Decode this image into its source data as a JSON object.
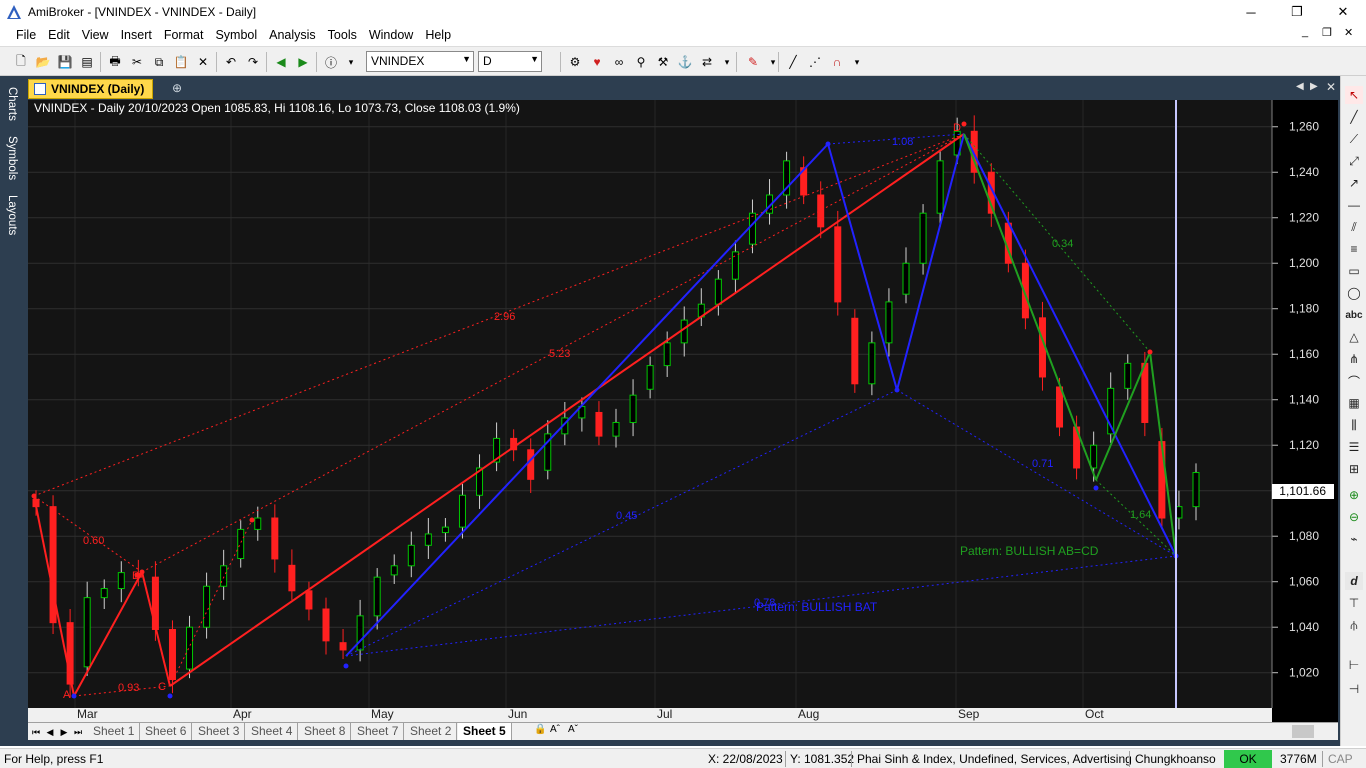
{
  "window": {
    "title": "AmiBroker - [VNINDEX - VNINDEX - Daily]"
  },
  "menu": {
    "items": [
      "File",
      "Edit",
      "View",
      "Insert",
      "Format",
      "Symbol",
      "Analysis",
      "Tools",
      "Window",
      "Help"
    ]
  },
  "toolbar": {
    "symbol_value": "VNINDEX",
    "interval_value": "D"
  },
  "sidebar": {
    "tabs": [
      "Charts",
      "Symbols",
      "Layouts"
    ]
  },
  "chart": {
    "tab_label": "VNINDEX (Daily)",
    "header": "VNINDEX - Daily 20/10/2023 Open 1085.83, Hi 1108.16, Lo 1073.73, Close 1108.03 (1.9%)",
    "last_price": "1,101.66",
    "pattern_green": "Pattern: BULLISH AB=CD",
    "pattern_blue": "Pattern: BULLISH BAT",
    "ratios": {
      "r1": "0.60",
      "r2": "0.93",
      "r3": "2.96",
      "r4": "5.23",
      "r5": "0.45",
      "r6": "1.08",
      "r7": "0.34",
      "r8": "0.71",
      "r9": "1.64",
      "r10": "0.78"
    },
    "points": {
      "A": "A",
      "B": "B",
      "C": "C",
      "D": "D"
    }
  },
  "chart_data": {
    "type": "candlestick",
    "title": "VNINDEX - Daily",
    "y_ticks": [
      1020,
      1040,
      1060,
      1080,
      1100,
      1120,
      1140,
      1160,
      1180,
      1200,
      1220,
      1240,
      1260
    ],
    "y_tick_labels": [
      "1,020",
      "1,040",
      "1,060",
      "1,080",
      "1,100",
      "1,120",
      "1,140",
      "1,160",
      "1,180",
      "1,200",
      "1,220",
      "1,240",
      "1,260"
    ],
    "x_month_labels": [
      "Mar",
      "Apr",
      "May",
      "Jun",
      "Jul",
      "Aug",
      "Sep",
      "Oct"
    ],
    "ylim": [
      1008,
      1270
    ],
    "last_value": 1101.66,
    "grid": true,
    "sample_closes": [
      1093,
      1042,
      1015,
      1053,
      1057,
      1064,
      1062,
      1039,
      1017,
      1040,
      1058,
      1067,
      1083,
      1088,
      1070,
      1056,
      1048,
      1034,
      1030,
      1045,
      1062,
      1067,
      1076,
      1081,
      1084,
      1098,
      1110,
      1123,
      1118,
      1105,
      1125,
      1132,
      1137,
      1124,
      1130,
      1142,
      1155,
      1165,
      1175,
      1182,
      1193,
      1205,
      1222,
      1230,
      1245,
      1230,
      1216,
      1183,
      1147,
      1165,
      1183,
      1200,
      1222,
      1245,
      1258,
      1240,
      1222,
      1200,
      1176,
      1150,
      1128,
      1110,
      1120,
      1145,
      1156,
      1130,
      1088,
      1093,
      1108
    ]
  },
  "sheets": [
    "Sheet 1",
    "Sheet 6",
    "Sheet 3",
    "Sheet 4",
    "Sheet 8",
    "Sheet 7",
    "Sheet 2",
    "Sheet 5"
  ],
  "status": {
    "help": "For Help, press F1",
    "x": "X: 22/08/2023",
    "y": "Y: 1081.352",
    "info": "Phai Sinh & Index, Undefined, Services, Advertising",
    "db": "Chungkhoanso",
    "ok": "OK",
    "mem": "3776M",
    "cap": "CAP"
  },
  "colors": {
    "bull": "#00c800",
    "bear": "#ff2020",
    "pattern_blue": "#2222ff",
    "pattern_red": "#ff2020",
    "pattern_green": "#20a020",
    "accent_tab": "#ffd84a"
  }
}
